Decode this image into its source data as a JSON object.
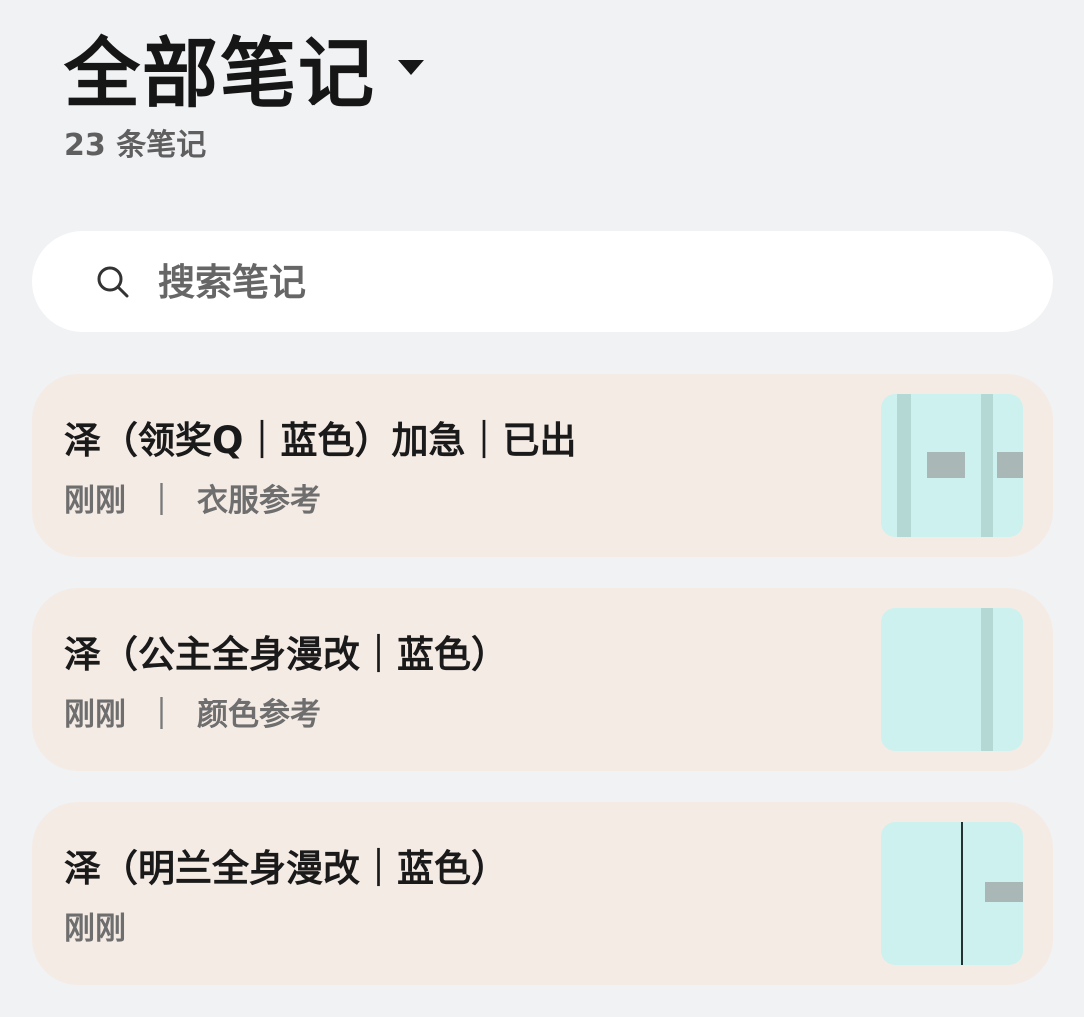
{
  "header": {
    "title": "全部笔记",
    "count": "23 条笔记"
  },
  "search": {
    "placeholder": "搜索笔记",
    "value": ""
  },
  "notes": [
    {
      "title": "泽（领奖Q｜蓝色）加急｜已出",
      "time": "刚刚",
      "separator": "｜",
      "category": "衣服参考"
    },
    {
      "title": "泽（公主全身漫改｜蓝色）",
      "time": "刚刚",
      "separator": "｜",
      "category": "颜色参考"
    },
    {
      "title": "泽（明兰全身漫改｜蓝色）",
      "time": "刚刚"
    }
  ],
  "colors": {
    "background": "#f1f2f4",
    "card": "#f5ebe5",
    "thumbnail": "#cdf1ee",
    "search_bg": "#ffffff"
  },
  "icons": {
    "title_dropdown": "chevron-down-icon",
    "search": "search-icon"
  }
}
